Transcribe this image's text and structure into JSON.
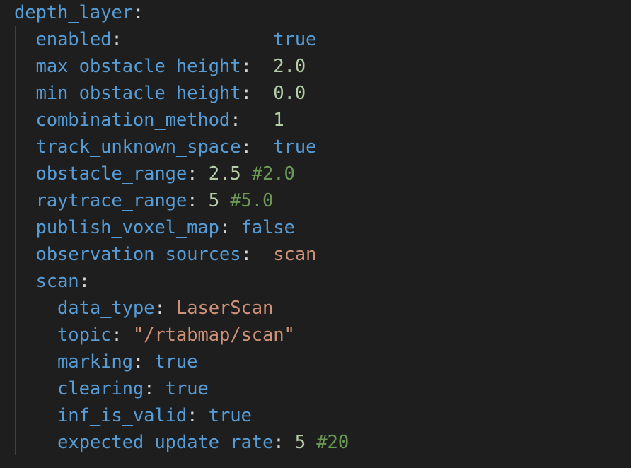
{
  "editor": {
    "language": "yaml",
    "current_line": 12,
    "colors": {
      "key": "#569cd6",
      "number": "#b5cea8",
      "string": "#ce9178",
      "boolean": "#569cd6",
      "comment": "#6a9955",
      "background": "#1e1e1e"
    },
    "lines": [
      {
        "indent": "",
        "tokens": [
          {
            "t": "depth_layer",
            "c": "k"
          },
          {
            "t": ":",
            "c": "p"
          }
        ]
      },
      {
        "indent": "  ",
        "tokens": [
          {
            "t": "enabled",
            "c": "k"
          },
          {
            "t": ":              ",
            "c": "p"
          },
          {
            "t": "true",
            "c": "b"
          }
        ]
      },
      {
        "indent": "  ",
        "tokens": [
          {
            "t": "max_obstacle_height",
            "c": "k"
          },
          {
            "t": ":  ",
            "c": "p"
          },
          {
            "t": "2.0",
            "c": "n"
          }
        ]
      },
      {
        "indent": "  ",
        "tokens": [
          {
            "t": "min_obstacle_height",
            "c": "k"
          },
          {
            "t": ":  ",
            "c": "p"
          },
          {
            "t": "0.0",
            "c": "n"
          }
        ]
      },
      {
        "indent": "  ",
        "tokens": [
          {
            "t": "combination_method",
            "c": "k"
          },
          {
            "t": ":   ",
            "c": "p"
          },
          {
            "t": "1",
            "c": "n"
          }
        ]
      },
      {
        "indent": "  ",
        "tokens": [
          {
            "t": "track_unknown_space",
            "c": "k"
          },
          {
            "t": ":  ",
            "c": "p"
          },
          {
            "t": "true",
            "c": "b"
          }
        ]
      },
      {
        "indent": "  ",
        "tokens": [
          {
            "t": "obstacle_range",
            "c": "k"
          },
          {
            "t": ": ",
            "c": "p"
          },
          {
            "t": "2.5",
            "c": "n"
          },
          {
            "t": " ",
            "c": "p"
          },
          {
            "t": "#2.0",
            "c": "c"
          }
        ]
      },
      {
        "indent": "  ",
        "tokens": [
          {
            "t": "raytrace_range",
            "c": "k"
          },
          {
            "t": ": ",
            "c": "p"
          },
          {
            "t": "5",
            "c": "n"
          },
          {
            "t": " ",
            "c": "p"
          },
          {
            "t": "#5.0",
            "c": "c"
          }
        ]
      },
      {
        "indent": "  ",
        "tokens": [
          {
            "t": "publish_voxel_map",
            "c": "k"
          },
          {
            "t": ": ",
            "c": "p"
          },
          {
            "t": "false",
            "c": "b"
          }
        ]
      },
      {
        "indent": "  ",
        "tokens": [
          {
            "t": "observation_sources",
            "c": "k"
          },
          {
            "t": ":  ",
            "c": "p"
          },
          {
            "t": "scan",
            "c": "s"
          }
        ]
      },
      {
        "indent": "  ",
        "tokens": [
          {
            "t": "scan",
            "c": "k"
          },
          {
            "t": ":",
            "c": "p"
          }
        ]
      },
      {
        "indent": "    ",
        "tokens": [
          {
            "t": "data_type",
            "c": "k"
          },
          {
            "t": ": ",
            "c": "p"
          },
          {
            "t": "LaserScan",
            "c": "s"
          }
        ]
      },
      {
        "indent": "    ",
        "tokens": [
          {
            "t": "topic",
            "c": "k"
          },
          {
            "t": ": ",
            "c": "p"
          },
          {
            "t": "\"/rtabmap/scan\"",
            "c": "s"
          }
        ]
      },
      {
        "indent": "    ",
        "tokens": [
          {
            "t": "marking",
            "c": "k"
          },
          {
            "t": ": ",
            "c": "p"
          },
          {
            "t": "true",
            "c": "b"
          }
        ]
      },
      {
        "indent": "    ",
        "tokens": [
          {
            "t": "clearing",
            "c": "k"
          },
          {
            "t": ": ",
            "c": "p"
          },
          {
            "t": "true",
            "c": "b"
          }
        ]
      },
      {
        "indent": "    ",
        "tokens": [
          {
            "t": "inf_is_valid",
            "c": "k"
          },
          {
            "t": ": ",
            "c": "p"
          },
          {
            "t": "true",
            "c": "b"
          }
        ]
      },
      {
        "indent": "    ",
        "tokens": [
          {
            "t": "expected_update_rate",
            "c": "k"
          },
          {
            "t": ": ",
            "c": "p"
          },
          {
            "t": "5",
            "c": "n"
          },
          {
            "t": " ",
            "c": "p"
          },
          {
            "t": "#20",
            "c": "c"
          }
        ]
      }
    ]
  }
}
